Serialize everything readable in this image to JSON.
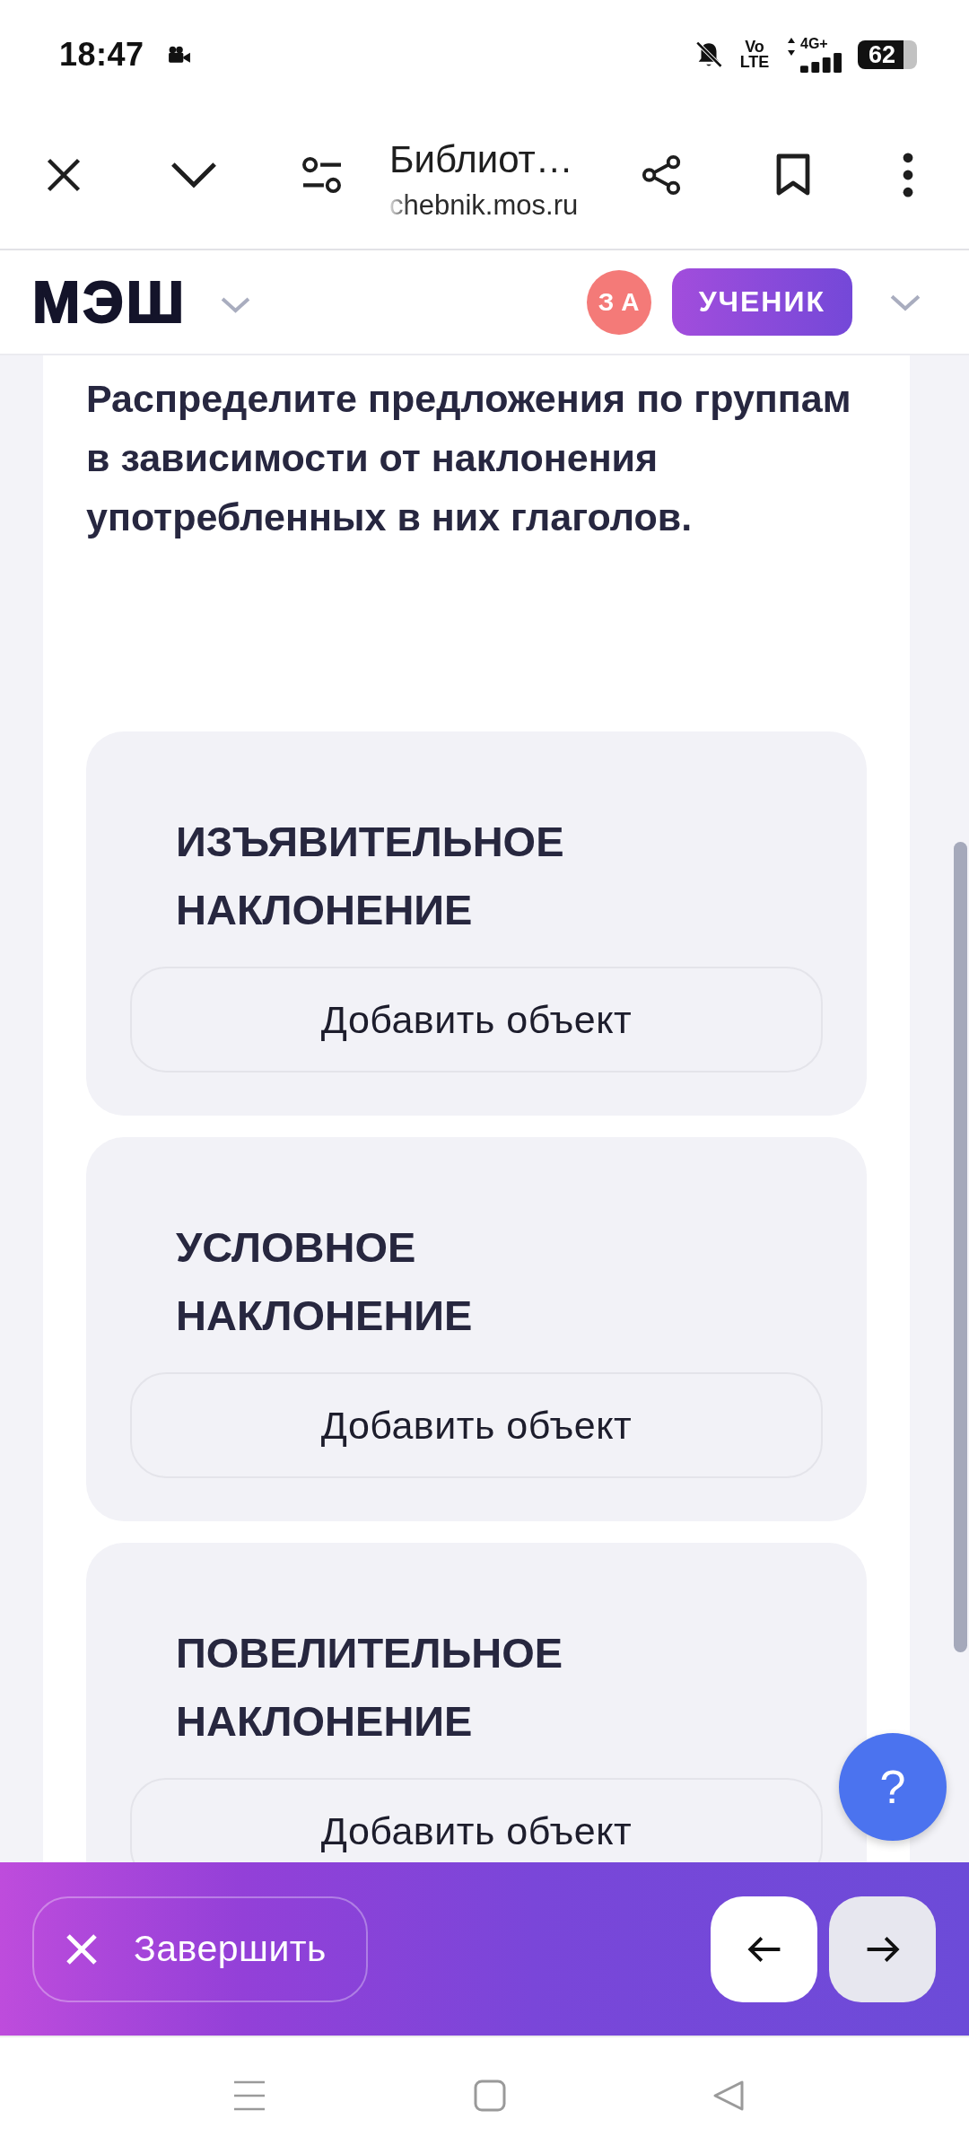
{
  "status_bar": {
    "time": "18:47",
    "volte": "Vo LTE",
    "network": "4G+",
    "battery": "62"
  },
  "browser_bar": {
    "title": "Библиот…",
    "url": "chebnik.mos.ru"
  },
  "header": {
    "logo": "МЭШ",
    "avatar_initials": "З А",
    "role": "УЧЕНИК"
  },
  "task": {
    "instruction": "Распределите предложения по группам в зависимости от наклонения употребленных в них глаголов."
  },
  "groups": [
    {
      "title": "ИЗЪЯВИТЕЛЬНОЕ НАКЛОНЕНИЕ",
      "add_label": "Добавить объект"
    },
    {
      "title": "УСЛОВНОЕ НАКЛОНЕНИЕ",
      "add_label": "Добавить объект"
    },
    {
      "title": "ПОВЕЛИТЕЛЬНОЕ НАКЛОНЕНИЕ",
      "add_label": "Добавить объект"
    }
  ],
  "help_button": "?",
  "footer": {
    "finish_label": "Завершить"
  }
}
